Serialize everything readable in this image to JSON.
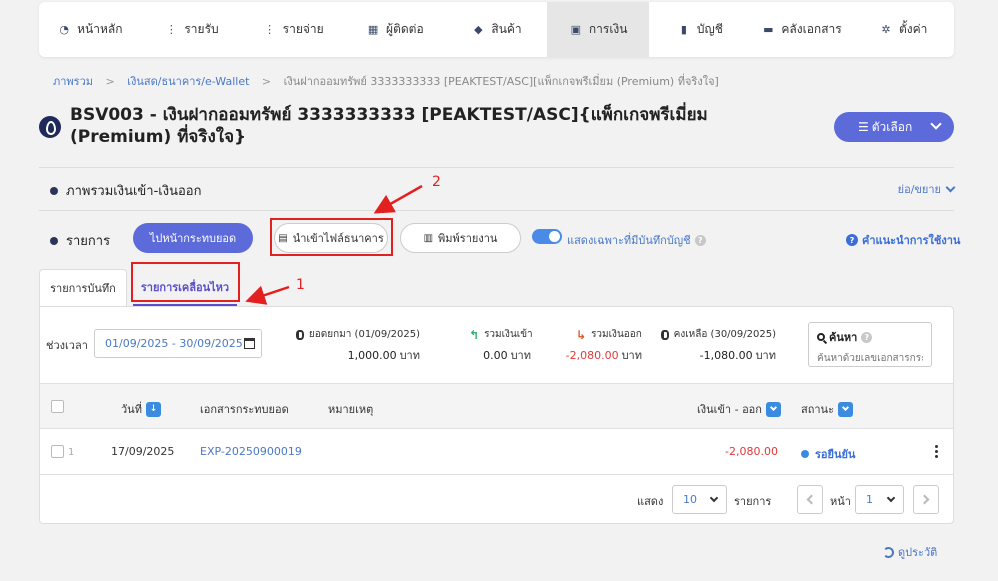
{
  "nav": {
    "items": [
      {
        "label": "หน้าหลัก",
        "icon": "gauge-icon"
      },
      {
        "label": "รายรับ",
        "icon": "income-icon"
      },
      {
        "label": "รายจ่าย",
        "icon": "expense-icon"
      },
      {
        "label": "ผู้ติดต่อ",
        "icon": "contact-icon"
      },
      {
        "label": "สินค้า",
        "icon": "box-icon"
      },
      {
        "label": "การเงิน",
        "icon": "money-icon",
        "active": true
      },
      {
        "label": "บัญชี",
        "icon": "ledger-icon"
      },
      {
        "label": "คลังเอกสาร",
        "icon": "folder-icon"
      },
      {
        "label": "ตั้งค่า",
        "icon": "gear-icon"
      }
    ]
  },
  "breadcrumb": {
    "items": [
      "ภาพรวม",
      "เงินสด/ธนาคาร/e-Wallet",
      "เงินฝากออมทรัพย์ 3333333333 [PEAKTEST/ASC][แพ็กเกจพรีเมี่ยม (Premium) ที่จริงใจ]"
    ]
  },
  "page": {
    "title": "BSV003 - เงินฝากออมทรัพย์ 3333333333 [PEAKTEST/ASC]{แพ็กเกจพรีเมี่ยม (Premium) ที่จริงใจ}",
    "options_label": "ตัวเลือก"
  },
  "overview": {
    "title": "ภาพรวมเงินเข้า-เงินออก",
    "toggle_label": "ย่อ/ขยาย"
  },
  "transactions": {
    "title": "รายการ",
    "btn_reconcile": "ไปหน้ากระทบยอด",
    "btn_import": "นำเข้าไฟล์ธนาคาร",
    "btn_print": "พิมพ์รายงาน",
    "switch_label": "แสดงเฉพาะที่มีบันทึกบัญชี",
    "switch_on": true,
    "help_label": "คำแนะนำการใช้งาน"
  },
  "tabs": {
    "recorded": "รายการบันทึก",
    "movement": "รายการเคลื่อนไหว"
  },
  "filters": {
    "period_label": "ช่วงเวลา",
    "period_value": "01/09/2025 - 30/09/2025",
    "search_title": "ค้นหา",
    "search_placeholder": "ค้นหาด้วยเลขเอกสารกระทบ"
  },
  "stats": {
    "opening_label": "ยอดยกมา (01/09/2025)",
    "opening_value": "1,000.00",
    "in_label": "รวมเงินเข้า",
    "in_value": "0.00",
    "out_label": "รวมเงินออก",
    "out_value": "-2,080.00",
    "balance_label": "คงเหลือ (30/09/2025)",
    "balance_value": "-1,080.00",
    "unit": "บาท"
  },
  "table": {
    "columns": [
      "วันที่",
      "เอกสารกระทบยอด",
      "หมายเหตุ",
      "เงินเข้า - ออก",
      "สถานะ"
    ],
    "rows": [
      {
        "num": "1",
        "date": "17/09/2025",
        "doc": "EXP-20250900019",
        "note": "",
        "amount": "-2,080.00",
        "status": "รอยืนยัน"
      }
    ]
  },
  "pagination": {
    "show_label": "แสดง",
    "page_size": "10",
    "items_label": "รายการ",
    "page_label": "หน้า",
    "page": "1"
  },
  "footer": {
    "history_label": "ดูประวัติ"
  },
  "annotations": {
    "marker_1": "1",
    "marker_2": "2"
  },
  "colors": {
    "accent": "#5c6bd9",
    "annotation": "#e32020",
    "negative": "#e03a3a",
    "link": "#4a78c8"
  }
}
